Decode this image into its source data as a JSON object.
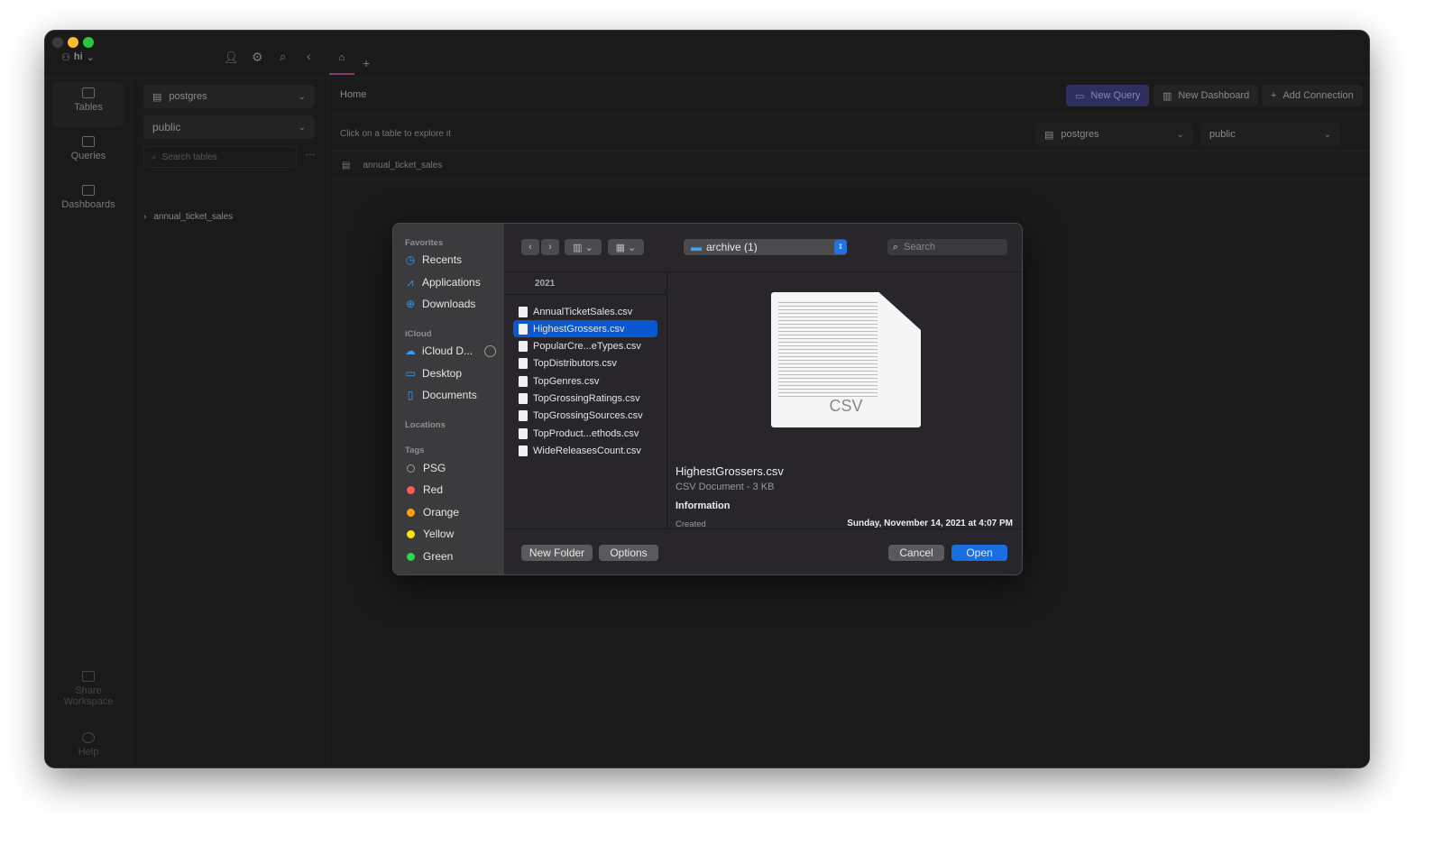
{
  "window": {
    "traffic_lights": {
      "close": "#3a3a3a",
      "minimize": "#febc2e",
      "zoom": "#28c840"
    },
    "workspace_name": "hi"
  },
  "nav": {
    "items": [
      {
        "label": "Tables",
        "icon": "table-icon"
      },
      {
        "label": "Queries",
        "icon": "terminal-icon"
      },
      {
        "label": "Dashboards",
        "icon": "chart-icon"
      }
    ],
    "share": "Share Workspace",
    "help": "Help"
  },
  "schema_panel": {
    "database": "postgres",
    "schema": "public",
    "search_placeholder": "Search tables",
    "tables": [
      "annual_ticket_sales"
    ]
  },
  "main": {
    "tab": "Home",
    "title": "Home",
    "hint": "Click on a table to explore it",
    "new_query": "New Query",
    "new_dashboard": "New Dashboard",
    "add_connection": "Add Connection",
    "database": "postgres",
    "schema": "public",
    "tables": [
      "annual_ticket_sales"
    ],
    "accent": "#3a3a7a"
  },
  "dialog": {
    "sidebar": {
      "favorites_header": "Favorites",
      "favorites": [
        {
          "label": "Recents",
          "icon": "clock-icon"
        },
        {
          "label": "Applications",
          "icon": "applications-icon"
        },
        {
          "label": "Downloads",
          "icon": "download-icon"
        }
      ],
      "icloud_header": "iCloud",
      "icloud": [
        {
          "label": "iCloud D...",
          "icon": "cloud-icon"
        },
        {
          "label": "Desktop",
          "icon": "desktop-icon"
        },
        {
          "label": "Documents",
          "icon": "document-icon"
        }
      ],
      "locations_header": "Locations",
      "tags_header": "Tags",
      "tags": [
        {
          "label": "PSG",
          "color": ""
        },
        {
          "label": "Red",
          "color": "#ff5a52"
        },
        {
          "label": "Orange",
          "color": "#ffa10a"
        },
        {
          "label": "Yellow",
          "color": "#ffe00a"
        },
        {
          "label": "Green",
          "color": "#2ad84a"
        }
      ]
    },
    "location": "archive (1)",
    "search_placeholder": "Search",
    "column_header": "2021",
    "files": [
      "AnnualTicketSales.csv",
      "HighestGrossers.csv",
      "PopularCre...eTypes.csv",
      "TopDistributors.csv",
      "TopGenres.csv",
      "TopGrossingRatings.csv",
      "TopGrossingSources.csv",
      "TopProduct...ethods.csv",
      "WideReleasesCount.csv"
    ],
    "selected_index": 1,
    "preview": {
      "icon_label": "CSV",
      "name": "HighestGrossers.csv",
      "kind": "CSV Document - 3 KB",
      "info_header": "Information",
      "created_label": "Created",
      "created_value": "Sunday, November 14, 2021 at 4:07 PM"
    },
    "new_folder": "New Folder",
    "options": "Options",
    "cancel": "Cancel",
    "open": "Open"
  }
}
